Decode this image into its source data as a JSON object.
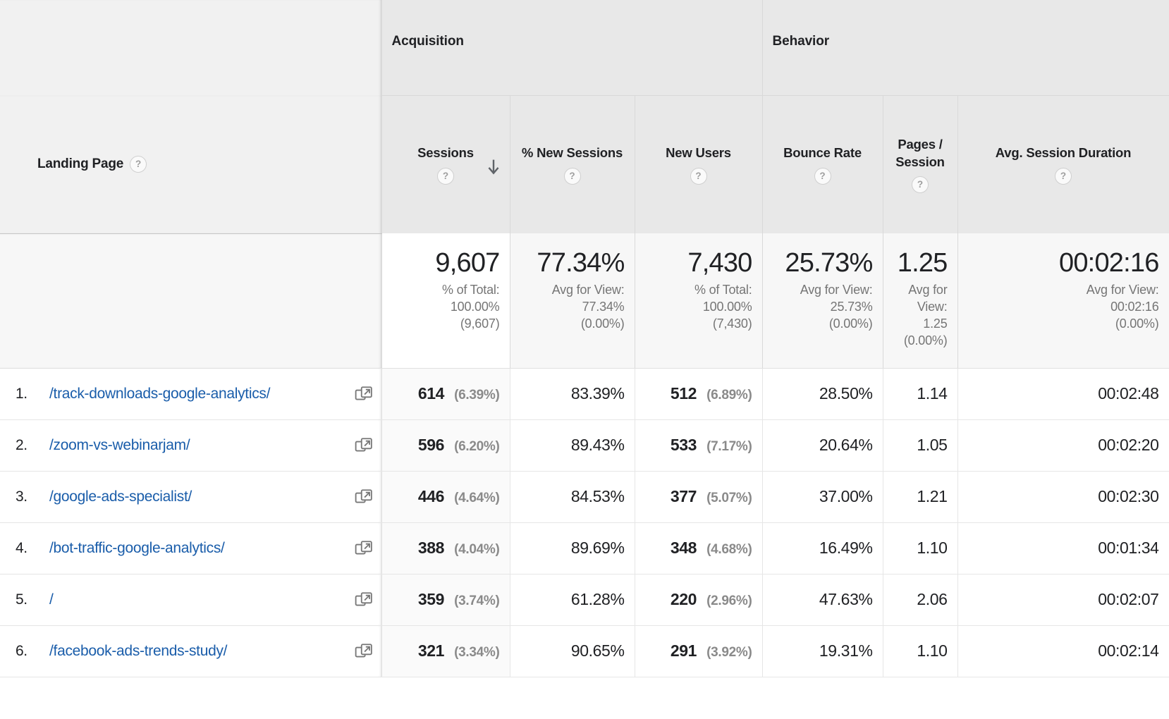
{
  "dimension": {
    "label": "Landing Page",
    "help_icon": "help-circle-icon"
  },
  "groups": [
    {
      "key": "acquisition",
      "label": "Acquisition",
      "span": 3
    },
    {
      "key": "behavior",
      "label": "Behavior",
      "span": 3
    }
  ],
  "columns": [
    {
      "key": "sessions",
      "label": "Sessions",
      "sorted": true,
      "sort_dir": "descending"
    },
    {
      "key": "pct_new_sessions",
      "label": "% New Sessions"
    },
    {
      "key": "new_users",
      "label": "New Users"
    },
    {
      "key": "bounce_rate",
      "label": "Bounce Rate"
    },
    {
      "key": "pages_session",
      "label": "Pages / Session"
    },
    {
      "key": "avg_session_duration",
      "label": "Avg. Session Duration"
    }
  ],
  "summary": {
    "sessions": {
      "value": "9,607",
      "lines": [
        "% of Total:",
        "100.00%",
        "(9,607)"
      ]
    },
    "pct_new_sessions": {
      "value": "77.34%",
      "lines": [
        "Avg for View:",
        "77.34%",
        "(0.00%)"
      ]
    },
    "new_users": {
      "value": "7,430",
      "lines": [
        "% of Total:",
        "100.00%",
        "(7,430)"
      ]
    },
    "bounce_rate": {
      "value": "25.73%",
      "lines": [
        "Avg for View:",
        "25.73%",
        "(0.00%)"
      ]
    },
    "pages_session": {
      "value": "1.25",
      "lines": [
        "Avg for",
        "View:",
        "1.25",
        "(0.00%)"
      ]
    },
    "avg_session_duration": {
      "value": "00:02:16",
      "lines": [
        "Avg for View:",
        "00:02:16",
        "(0.00%)"
      ]
    }
  },
  "rows": [
    {
      "index": "1.",
      "page": "/track-downloads-google-analytics/",
      "sessions": "614",
      "sessions_pct": "(6.39%)",
      "pct_new_sessions": "83.39%",
      "new_users": "512",
      "new_users_pct": "(6.89%)",
      "bounce_rate": "28.50%",
      "pages_session": "1.14",
      "avg_session_duration": "00:02:48"
    },
    {
      "index": "2.",
      "page": "/zoom-vs-webinarjam/",
      "sessions": "596",
      "sessions_pct": "(6.20%)",
      "pct_new_sessions": "89.43%",
      "new_users": "533",
      "new_users_pct": "(7.17%)",
      "bounce_rate": "20.64%",
      "pages_session": "1.05",
      "avg_session_duration": "00:02:20"
    },
    {
      "index": "3.",
      "page": "/google-ads-specialist/",
      "sessions": "446",
      "sessions_pct": "(4.64%)",
      "pct_new_sessions": "84.53%",
      "new_users": "377",
      "new_users_pct": "(5.07%)",
      "bounce_rate": "37.00%",
      "pages_session": "1.21",
      "avg_session_duration": "00:02:30"
    },
    {
      "index": "4.",
      "page": "/bot-traffic-google-analytics/",
      "sessions": "388",
      "sessions_pct": "(4.04%)",
      "pct_new_sessions": "89.69%",
      "new_users": "348",
      "new_users_pct": "(4.68%)",
      "bounce_rate": "16.49%",
      "pages_session": "1.10",
      "avg_session_duration": "00:01:34"
    },
    {
      "index": "5.",
      "page": "/",
      "sessions": "359",
      "sessions_pct": "(3.74%)",
      "pct_new_sessions": "61.28%",
      "new_users": "220",
      "new_users_pct": "(2.96%)",
      "bounce_rate": "47.63%",
      "pages_session": "2.06",
      "avg_session_duration": "00:02:07"
    },
    {
      "index": "6.",
      "page": "/facebook-ads-trends-study/",
      "sessions": "321",
      "sessions_pct": "(3.34%)",
      "pct_new_sessions": "90.65%",
      "new_users": "291",
      "new_users_pct": "(3.92%)",
      "bounce_rate": "19.31%",
      "pages_session": "1.10",
      "avg_session_duration": "00:02:14"
    }
  ],
  "icons": {
    "external_link": "external-link-icon",
    "sort_arrow": "sort-descending-arrow-icon",
    "help": "help-circle-icon"
  },
  "colors": {
    "link": "#1a5daa",
    "header_bg": "#e8e8e8",
    "dimension_header_bg": "#f1f1f1",
    "summary_bg": "#f7f7f7",
    "sorted_column_bg": "#fafafa",
    "muted_text": "#8a8a8a"
  }
}
